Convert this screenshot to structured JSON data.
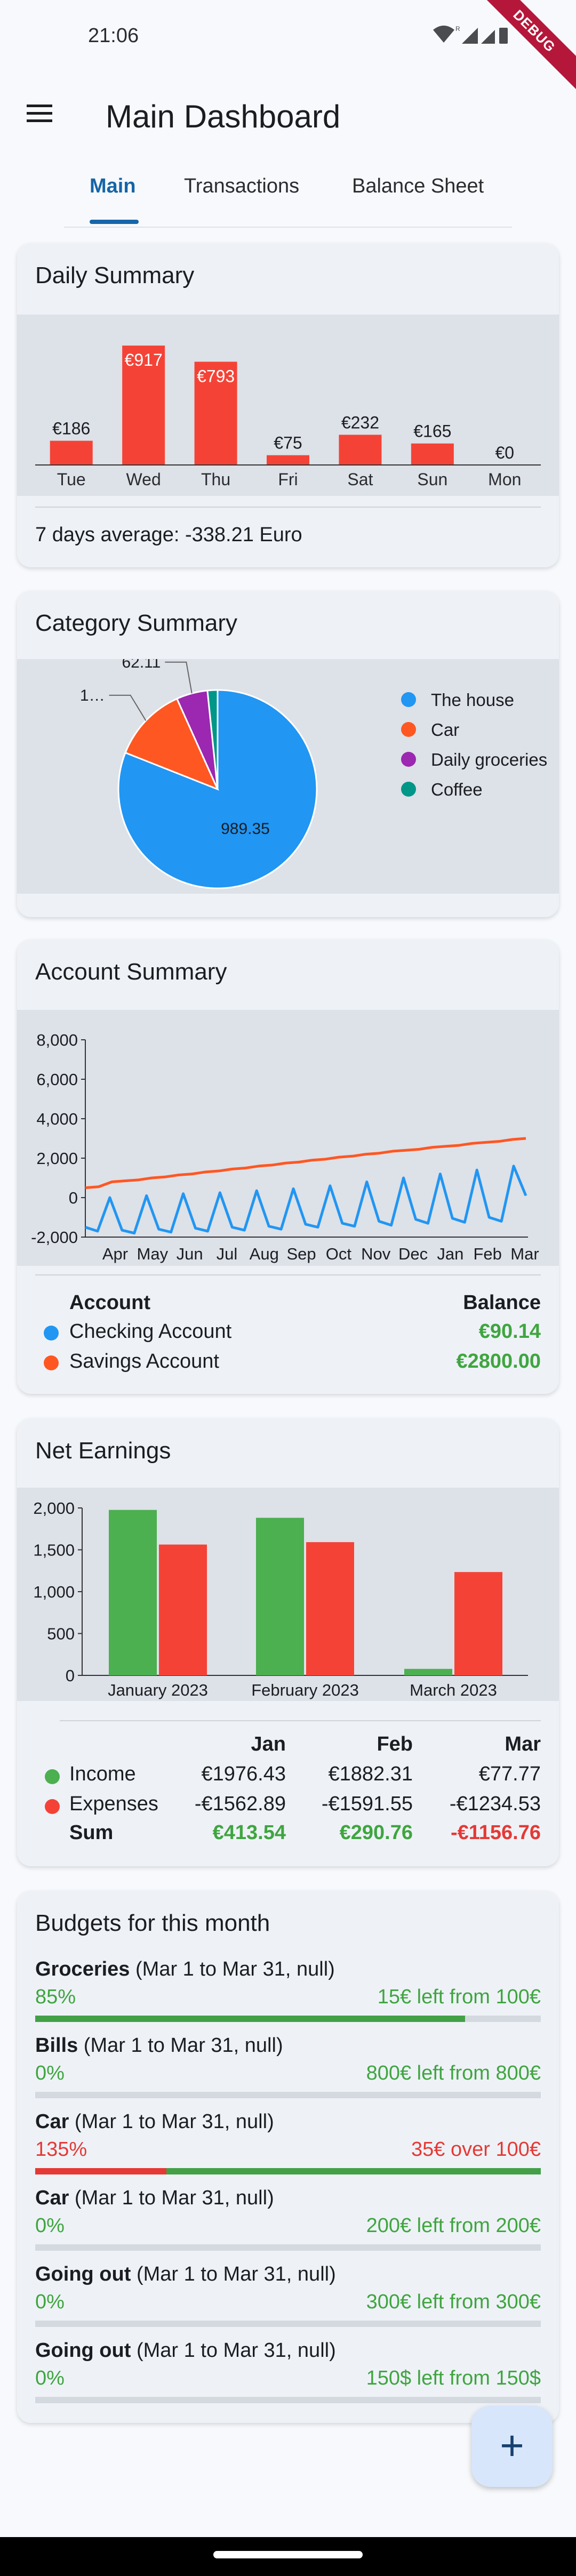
{
  "status_bar": {
    "time": "21:06",
    "debug_banner": "DEBUG"
  },
  "app_bar": {
    "title": "Main Dashboard",
    "menu_icon": "hamburger-menu-icon"
  },
  "tabs": [
    {
      "label": "Main",
      "active": true
    },
    {
      "label": "Transactions",
      "active": false
    },
    {
      "label": "Balance Sheet",
      "active": false
    }
  ],
  "daily_summary": {
    "title": "Daily Summary",
    "average_text": "7 days average: -338.21 Euro",
    "chart_data": {
      "type": "bar",
      "categories": [
        "Tue",
        "Wed",
        "Thu",
        "Fri",
        "Sat",
        "Sun",
        "Mon"
      ],
      "values": [
        186,
        917,
        793,
        75,
        232,
        165,
        0
      ],
      "data_labels": [
        "€186",
        "€917",
        "€793",
        "€75",
        "€232",
        "€165",
        "€0"
      ],
      "bar_color": "#f44336",
      "ylim": [
        0,
        1000
      ]
    }
  },
  "category_summary": {
    "title": "Category Summary",
    "chart_data": {
      "type": "pie",
      "labels": [
        "The house",
        "Car",
        "Daily groceries",
        "Coffee"
      ],
      "values": [
        989.35,
        150,
        62.11,
        20
      ],
      "value_labels": [
        "989.35",
        "1…",
        "62.11",
        ""
      ],
      "colors": [
        "#2196f3",
        "#ff5722",
        "#9c27b0",
        "#009688"
      ]
    }
  },
  "account_summary": {
    "title": "Account Summary",
    "chart_data": {
      "type": "line",
      "x_ticks": [
        "Apr",
        "May",
        "Jun",
        "Jul",
        "Aug",
        "Sep",
        "Oct",
        "Nov",
        "Dec",
        "Jan",
        "Feb",
        "Mar"
      ],
      "y_ticks": [
        "8,000",
        "6,000",
        "4,000",
        "2,000",
        "0",
        "-2,000"
      ],
      "ylim": [
        -2000,
        8000
      ],
      "series": [
        {
          "color": "#2196f3",
          "values": [
            -1500,
            -1700,
            0,
            -1650,
            -1800,
            100,
            -1600,
            -1750,
            200,
            -1550,
            -1700,
            250,
            -1500,
            -1650,
            350,
            -1450,
            -1600,
            450,
            -1350,
            -1500,
            600,
            -1300,
            -1450,
            800,
            -1200,
            -1400,
            1000,
            -1100,
            -1300,
            1200,
            -1050,
            -1250,
            1400,
            -1000,
            -1200,
            1600,
            100
          ]
        },
        {
          "color": "#ff5722",
          "values": [
            500,
            550,
            800,
            850,
            900,
            1000,
            1050,
            1150,
            1200,
            1300,
            1350,
            1450,
            1500,
            1600,
            1650,
            1750,
            1800,
            1900,
            1950,
            2050,
            2100,
            2200,
            2250,
            2350,
            2400,
            2450,
            2550,
            2600,
            2650,
            2750,
            2800,
            2850,
            2950,
            3000
          ]
        }
      ]
    },
    "table_header": {
      "account": "Account",
      "balance": "Balance"
    },
    "accounts": [
      {
        "name": "Checking Account",
        "balance": "€90.14",
        "color": "#2196f3"
      },
      {
        "name": "Savings Account",
        "balance": "€2800.00",
        "color": "#ff5722"
      }
    ]
  },
  "net_earnings": {
    "title": "Net Earnings",
    "chart_data": {
      "type": "bar",
      "categories": [
        "January 2023",
        "February 2023",
        "March 2023"
      ],
      "y_ticks": [
        "2,000",
        "1,500",
        "1,000",
        "500",
        "0"
      ],
      "ylim": [
        0,
        2000
      ],
      "series": [
        {
          "name": "Income",
          "values": [
            1976.43,
            1882.31,
            77.77
          ],
          "color": "#4caf50"
        },
        {
          "name": "Expenses",
          "values": [
            1562.89,
            1591.55,
            1234.53
          ],
          "color": "#f44336"
        }
      ]
    },
    "table": {
      "columns": [
        "Jan",
        "Feb",
        "Mar"
      ],
      "rows": [
        {
          "label": "Income",
          "color": "#4caf50",
          "values": [
            "€1976.43",
            "€1882.31",
            "€77.77"
          ]
        },
        {
          "label": "Expenses",
          "color": "#f44336",
          "values": [
            "-€1562.89",
            "-€1591.55",
            "-€1234.53"
          ]
        },
        {
          "label": "Sum",
          "values": [
            "€413.54",
            "€290.76",
            "-€1156.76"
          ]
        }
      ]
    }
  },
  "budgets": {
    "title": "Budgets for this month",
    "items": [
      {
        "name": "Groceries",
        "range": " (Mar 1 to Mar 31, null)",
        "percent": "85%",
        "status": "15€ left from 100€",
        "progress": 0.85,
        "over": false
      },
      {
        "name": "Bills",
        "range": " (Mar 1 to Mar 31, null)",
        "percent": "0%",
        "status": "800€ left from 800€",
        "progress": 0,
        "over": false
      },
      {
        "name": "Car",
        "range": " (Mar 1 to Mar 31, null)",
        "percent": "135%",
        "status": "35€ over 100€",
        "progress": 1.35,
        "over": true
      },
      {
        "name": "Car",
        "range": " (Mar 1 to Mar 31, null)",
        "percent": "0%",
        "status": "200€ left from 200€",
        "progress": 0,
        "over": false
      },
      {
        "name": "Going out",
        "range": " (Mar 1 to Mar 31, null)",
        "percent": "0%",
        "status": "300€ left from 300€",
        "progress": 0,
        "over": false
      },
      {
        "name": "Going out",
        "range": " (Mar 1 to Mar 31, null)",
        "percent": "0%",
        "status": "150$ left from 150$",
        "progress": 0,
        "over": false
      }
    ]
  },
  "fab": {
    "icon": "plus-icon",
    "label": "+"
  }
}
